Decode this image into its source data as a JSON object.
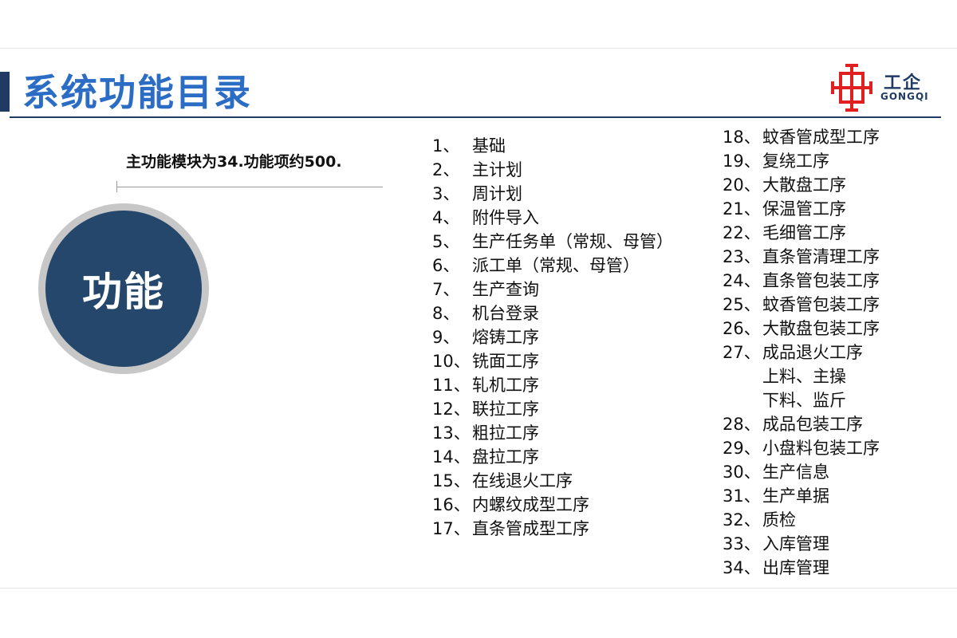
{
  "header": {
    "title": "系统功能目录",
    "logo": {
      "text_cn": "工企",
      "text_en": "GONGQI",
      "icon": "gongqi-logo-icon",
      "color": "#e02020"
    }
  },
  "summary": "主功能模块为34.功能项约500.",
  "badge": {
    "label": "功能"
  },
  "colors": {
    "title_blue": "#2b6cc4",
    "navy": "#1f3a63",
    "circle_fill": "#24476b",
    "circle_ring": "#c7c7c7"
  },
  "modules_left": [
    {
      "num": "1、",
      "label": "基础"
    },
    {
      "num": "2、",
      "label": "主计划"
    },
    {
      "num": "3、",
      "label": "周计划"
    },
    {
      "num": "4、",
      "label": "附件导入"
    },
    {
      "num": "5、",
      "label": "生产任务单（常规、母管）"
    },
    {
      "num": "6、",
      "label": "派工单（常规、母管）"
    },
    {
      "num": "7、",
      "label": "生产查询"
    },
    {
      "num": "8、",
      "label": "机台登录"
    },
    {
      "num": "9、",
      "label": "熔铸工序"
    },
    {
      "num": "10、",
      "label": "铣面工序"
    },
    {
      "num": "11、",
      "label": "轧机工序"
    },
    {
      "num": "12、",
      "label": "联拉工序"
    },
    {
      "num": "13、",
      "label": "粗拉工序"
    },
    {
      "num": "14、",
      "label": "盘拉工序"
    },
    {
      "num": "15、",
      "label": "在线退火工序"
    },
    {
      "num": "16、",
      "label": "内螺纹成型工序"
    },
    {
      "num": "17、",
      "label": "直条管成型工序"
    }
  ],
  "modules_right": [
    {
      "num": "18、",
      "label": "蚊香管成型工序"
    },
    {
      "num": "19、",
      "label": "复绕工序"
    },
    {
      "num": "20、",
      "label": "大散盘工序"
    },
    {
      "num": "21、",
      "label": "保温管工序"
    },
    {
      "num": "22、",
      "label": "毛细管工序"
    },
    {
      "num": "23、",
      "label": "直条管清理工序"
    },
    {
      "num": "24、",
      "label": "直条管包装工序"
    },
    {
      "num": "25、",
      "label": "蚊香管包装工序"
    },
    {
      "num": "26、",
      "label": "大散盘包装工序"
    },
    {
      "num": "27、",
      "label": "成品退火工序"
    },
    {
      "num": "",
      "label": "上料、主操"
    },
    {
      "num": "",
      "label": "下料、监斤"
    },
    {
      "num": "28、",
      "label": "成品包装工序"
    },
    {
      "num": "29、",
      "label": "小盘料包装工序"
    },
    {
      "num": "30、",
      "label": "生产信息"
    },
    {
      "num": "31、",
      "label": "生产单据"
    },
    {
      "num": "32、",
      "label": "质检"
    },
    {
      "num": "33、",
      "label": "入库管理"
    },
    {
      "num": "34、",
      "label": "出库管理"
    }
  ]
}
